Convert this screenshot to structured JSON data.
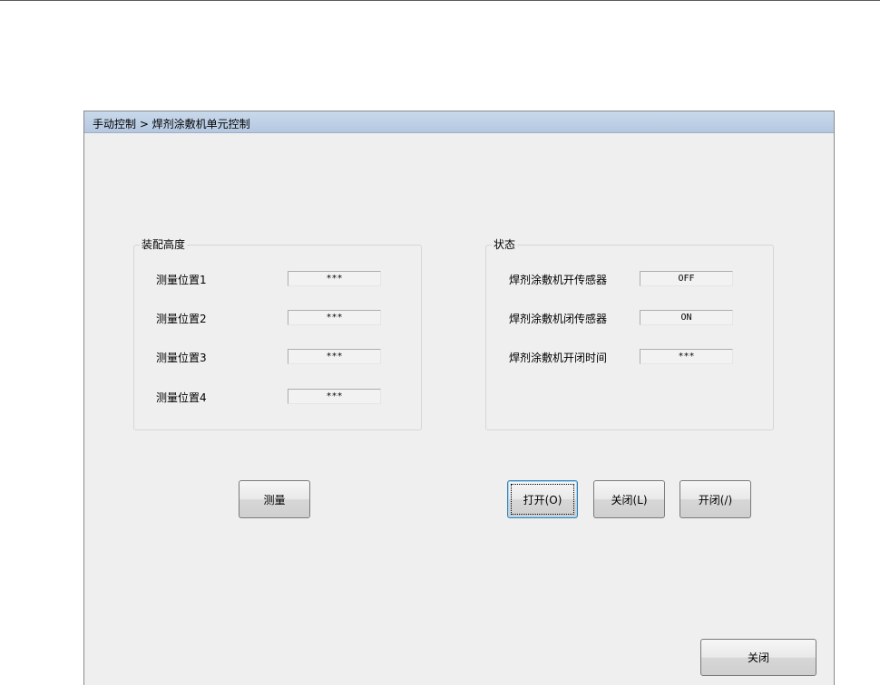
{
  "breadcrumb": "手动控制 > 焊剂涂敷机单元控制",
  "assembly_height": {
    "title": "装配高度",
    "rows": [
      {
        "label": "测量位置1",
        "value": "***"
      },
      {
        "label": "测量位置2",
        "value": "***"
      },
      {
        "label": "测量位置3",
        "value": "***"
      },
      {
        "label": "测量位置4",
        "value": "***"
      }
    ]
  },
  "status": {
    "title": "状态",
    "rows": [
      {
        "label": "焊剂涂敷机开传感器",
        "value": "OFF"
      },
      {
        "label": "焊剂涂敷机闭传感器",
        "value": "ON"
      },
      {
        "label": "焊剂涂敷机开闭时间",
        "value": "***"
      }
    ]
  },
  "buttons": {
    "measure": "测量",
    "open": "打开(O)",
    "close_unit": "关闭(L)",
    "open_close": "开闭(/)",
    "close_window": "关闭"
  },
  "colors": {
    "titlebar": "#c4d5ea",
    "panel_bg": "#efefef",
    "focus_border": "#3c7fb1"
  }
}
